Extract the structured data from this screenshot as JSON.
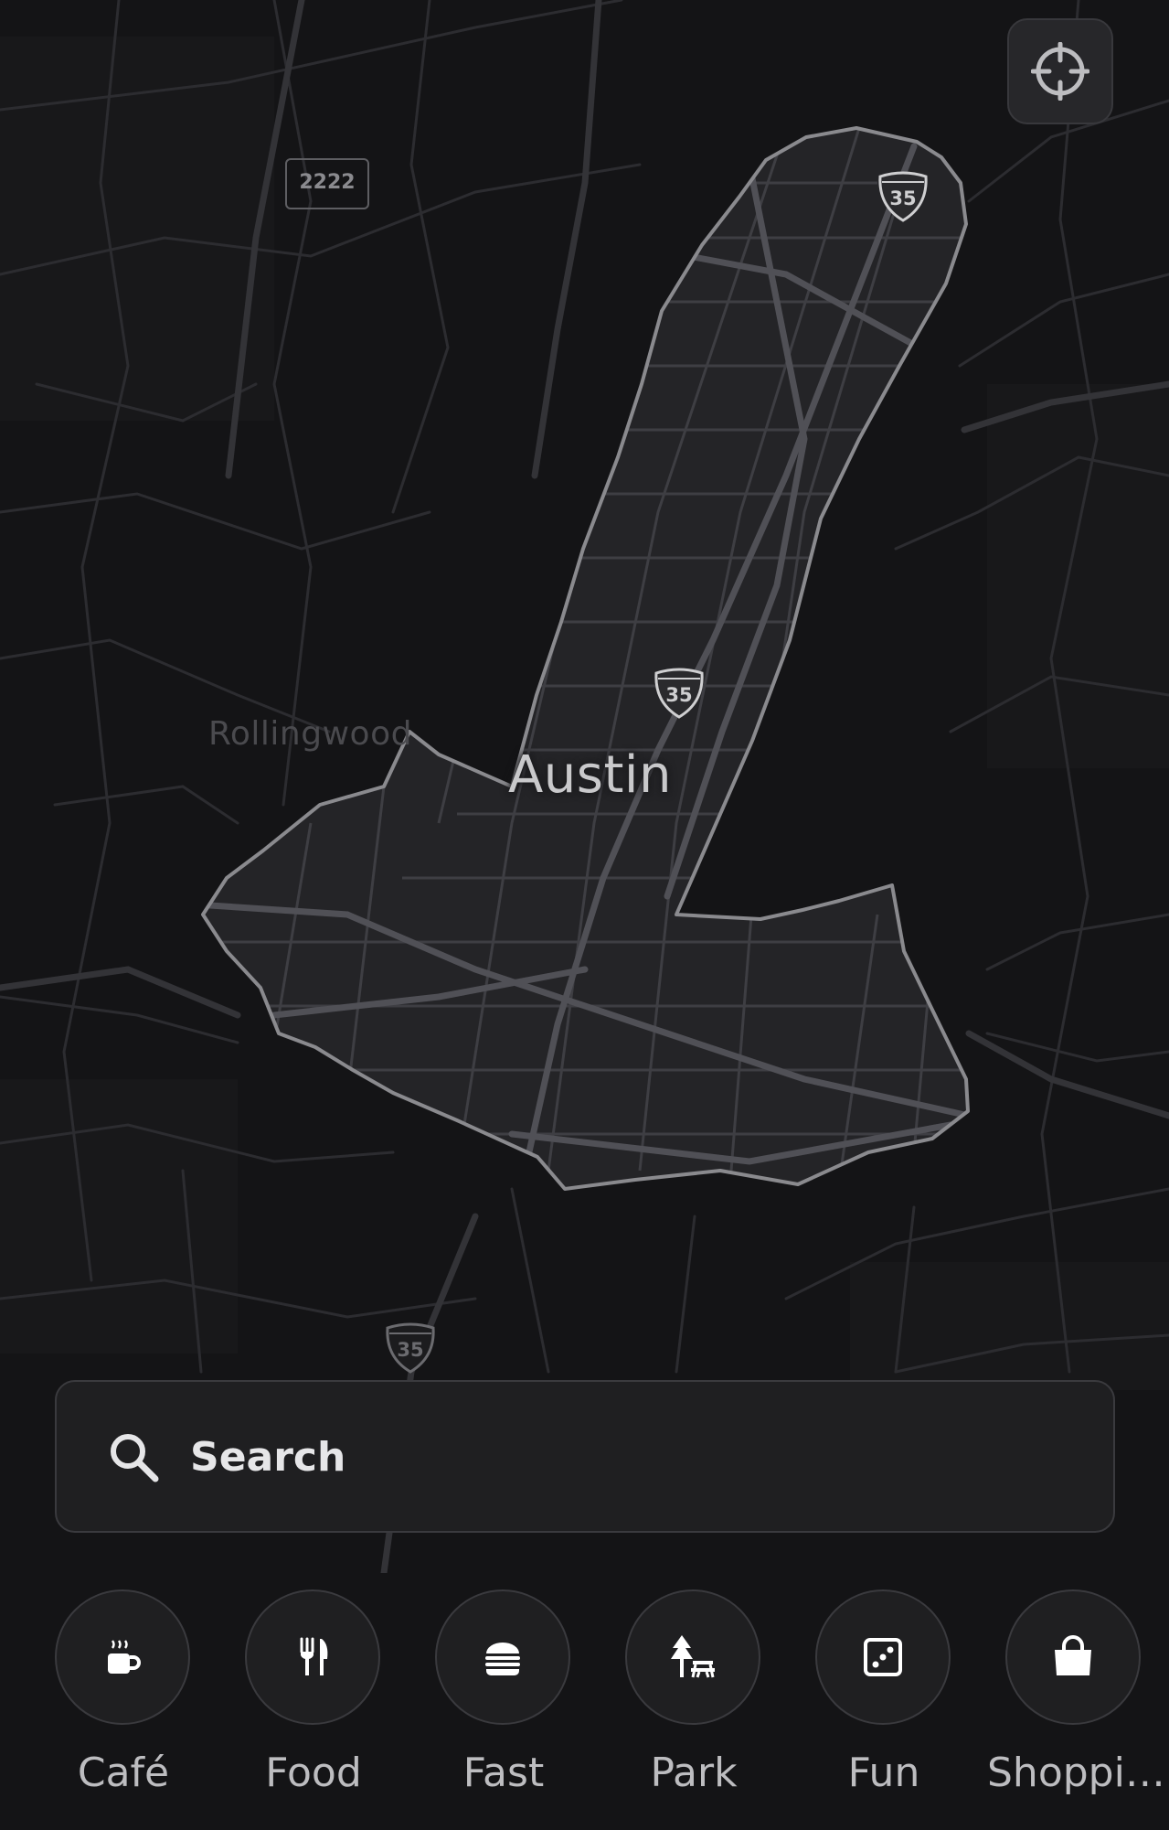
{
  "map": {
    "place_labels": {
      "rollingwood": "Rollingwood",
      "austin": "Austin"
    },
    "highway_shields": {
      "interstate_north": "35",
      "interstate_center": "35",
      "interstate_south": "35",
      "state_highway": "2222"
    },
    "colors": {
      "background": "#141416",
      "roads": "#2f2f33",
      "highlight_area_fill": "#242427",
      "highlight_area_outline": "#8a8a8e",
      "highlight_roads": "#4a4a4f"
    }
  },
  "controls": {
    "locate_button_icon": "crosshair-icon"
  },
  "search": {
    "placeholder": "Search",
    "icon": "search-icon"
  },
  "categories": [
    {
      "label": "Café",
      "icon": "coffee-cup-icon"
    },
    {
      "label": "Food",
      "icon": "fork-knife-icon"
    },
    {
      "label": "Fast",
      "icon": "burger-icon"
    },
    {
      "label": "Park",
      "icon": "tree-bench-icon"
    },
    {
      "label": "Fun",
      "icon": "dice-icon"
    },
    {
      "label": "Shoppi…",
      "icon": "shopping-bag-icon"
    }
  ]
}
